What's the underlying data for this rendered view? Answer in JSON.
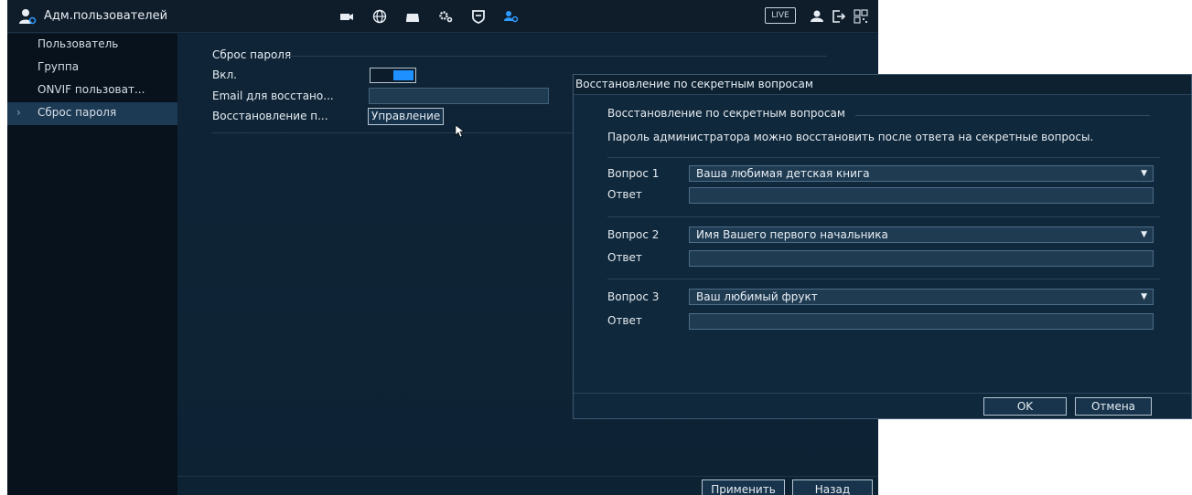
{
  "topbar": {
    "title": "Адм.пользователей",
    "icons": [
      "user-admin-icon",
      "camera-icon",
      "globe-icon",
      "storage-icon",
      "settings-icon",
      "shield-icon",
      "users-icon"
    ],
    "live_label": "LIVE",
    "right_icons": [
      "user-icon",
      "logout-icon",
      "qr-code-icon"
    ],
    "accent_color": "#2f9bff"
  },
  "sidebar": {
    "items": [
      {
        "label": "Пользователь"
      },
      {
        "label": "Группа"
      },
      {
        "label": "ONVIF пользоват..."
      },
      {
        "label": "Сброс пароля",
        "active": true,
        "chevron": "›"
      }
    ]
  },
  "main": {
    "section_title": "Сброс пароля",
    "enable_label": "Вкл.",
    "email_label": "Email для восстано...",
    "email_value": "",
    "recovery_label": "Восстановление п...",
    "manage_button": "Управление",
    "apply_button": "Применить",
    "back_button": "Назад"
  },
  "dialog": {
    "title": "Восстановление по секретным вопросам",
    "section_title": "Восстановление по секретным вопросам",
    "description": "Пароль администратора можно восстановить после ответа на секретные вопросы.",
    "questions": [
      {
        "label": "Вопрос 1",
        "value": "Ваша любимая детская книга",
        "answer_label": "Ответ",
        "answer": ""
      },
      {
        "label": "Вопрос 2",
        "value": "Имя Вашего первого начальника",
        "answer_label": "Ответ",
        "answer": ""
      },
      {
        "label": "Вопрос 3",
        "value": "Ваш любимый фрукт",
        "answer_label": "Ответ",
        "answer": ""
      }
    ],
    "ok_button": "OK",
    "cancel_button": "Отмена",
    "dropdown_arrow": "▼"
  }
}
